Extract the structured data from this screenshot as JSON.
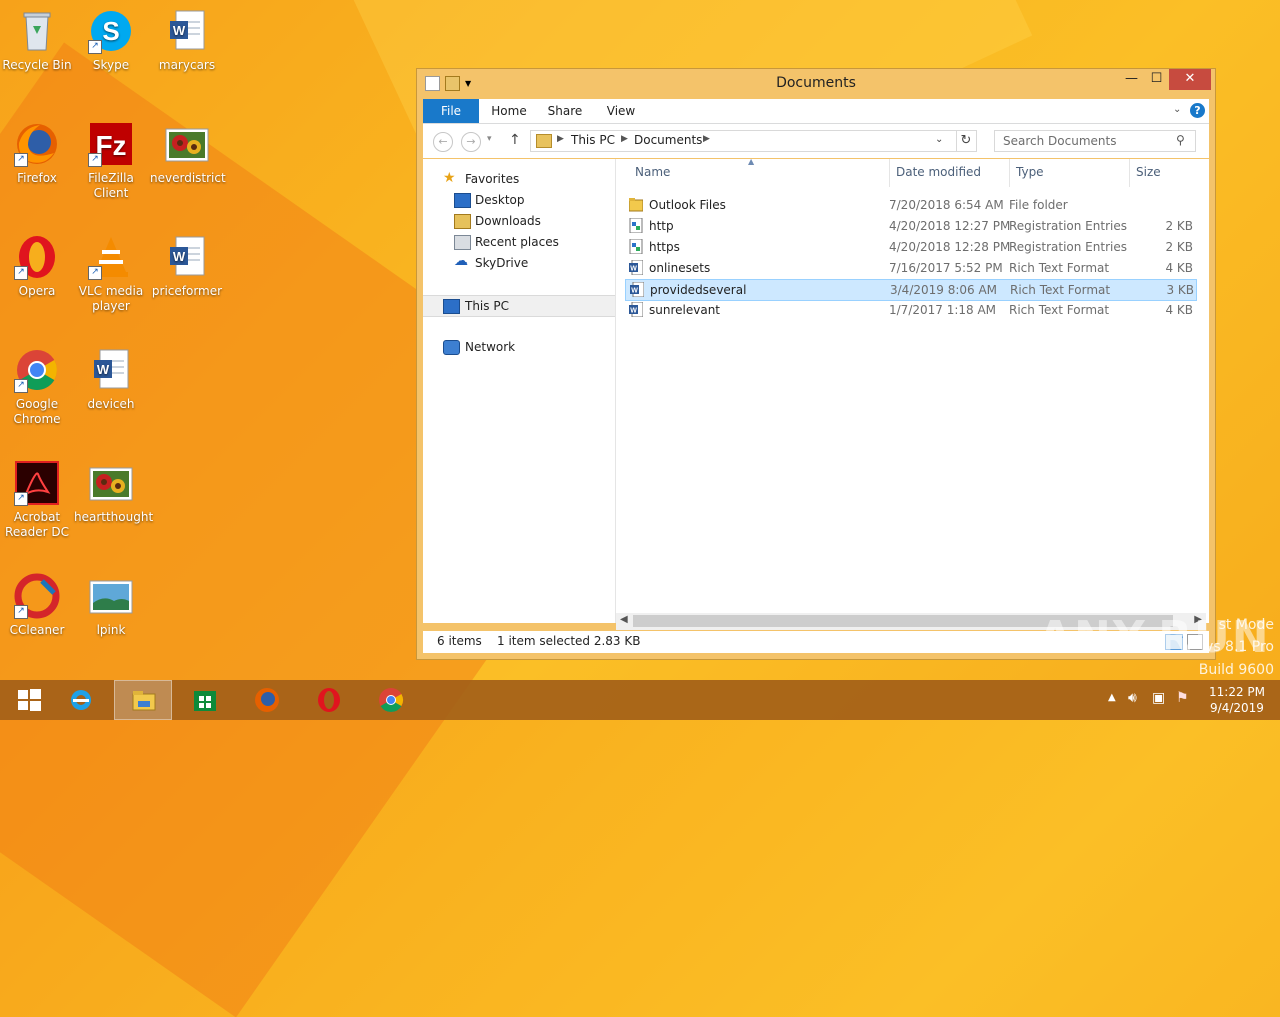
{
  "desktop": {
    "icons": [
      {
        "label": "Recycle Bin"
      },
      {
        "label": "Skype"
      },
      {
        "label": "marycars"
      },
      {
        "label": "Firefox"
      },
      {
        "label": "FileZilla Client"
      },
      {
        "label": "neverdistrict"
      },
      {
        "label": "Opera"
      },
      {
        "label": "VLC media player"
      },
      {
        "label": "priceformer"
      },
      {
        "label": "Google Chrome"
      },
      {
        "label": "deviceh"
      },
      {
        "label": "Acrobat Reader DC"
      },
      {
        "label": "heartthought"
      },
      {
        "label": "CCleaner"
      },
      {
        "label": "lpink"
      }
    ]
  },
  "window": {
    "title": "Documents",
    "close_glyph": "✕",
    "max_glyph": "☐",
    "min_glyph": "—"
  },
  "ribbon": {
    "tabs": [
      "File",
      "Home",
      "Share",
      "View"
    ],
    "help": "?"
  },
  "address": {
    "crumbs": [
      "This PC",
      "Documents"
    ],
    "search_placeholder": "Search Documents"
  },
  "nav_pane": {
    "favorites": "Favorites",
    "desktop": "Desktop",
    "downloads": "Downloads",
    "recent": "Recent places",
    "skydrive": "SkyDrive",
    "this_pc": "This PC",
    "network": "Network"
  },
  "columns": [
    "Name",
    "Date modified",
    "Type",
    "Size"
  ],
  "files": [
    {
      "name": "Outlook Files",
      "date": "7/20/2018 6:54 AM",
      "type": "File folder",
      "size": "",
      "icon": "folder-icon"
    },
    {
      "name": "http",
      "date": "4/20/2018 12:27 PM",
      "type": "Registration Entries",
      "size": "2 KB",
      "icon": "registry-file-icon"
    },
    {
      "name": "https",
      "date": "4/20/2018 12:28 PM",
      "type": "Registration Entries",
      "size": "2 KB",
      "icon": "registry-file-icon"
    },
    {
      "name": "onlinesets",
      "date": "7/16/2017 5:52 PM",
      "type": "Rich Text Format",
      "size": "4 KB",
      "icon": "word-doc-icon"
    },
    {
      "name": "providedseveral",
      "date": "3/4/2019 8:06 AM",
      "type": "Rich Text Format",
      "size": "3 KB",
      "icon": "word-doc-icon",
      "selected": true
    },
    {
      "name": "sunrelevant",
      "date": "1/7/2017 1:18 AM",
      "type": "Rich Text Format",
      "size": "4 KB",
      "icon": "word-doc-icon"
    }
  ],
  "status": {
    "items": "6 items",
    "selection": "1 item selected  2.83 KB"
  },
  "watermark": {
    "line1": "st Mode",
    "line2": "vs 8.1 Pro",
    "line3": "Build 9600",
    "brand": "ANY.RUN"
  },
  "clock": {
    "time": "11:22 PM",
    "date": "9/4/2019"
  },
  "colors": {
    "accent": "#1979ca",
    "selection": "#cde8ff",
    "close": "#c74b3f"
  }
}
